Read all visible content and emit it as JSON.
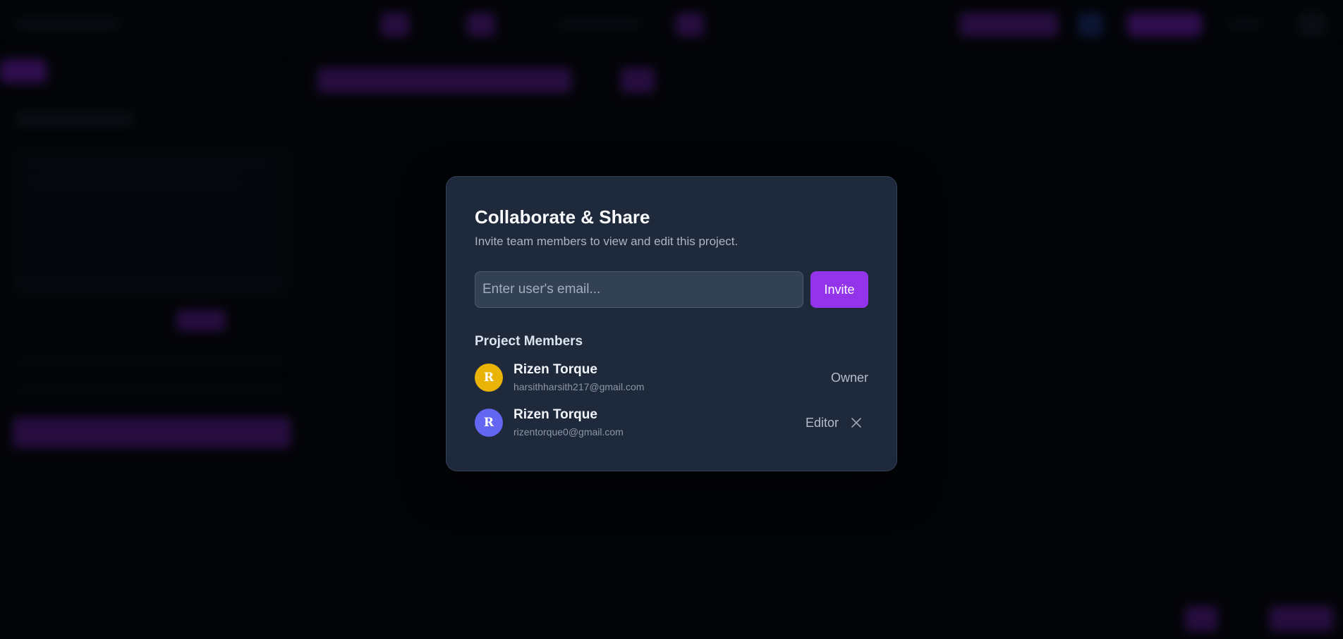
{
  "modal": {
    "title": "Collaborate & Share",
    "subtitle": "Invite team members to view and edit this project.",
    "email_placeholder": "Enter user's email...",
    "email_value": "",
    "invite_label": "Invite",
    "members_heading": "Project Members"
  },
  "members": [
    {
      "initial": "R",
      "name": "Rizen Torque",
      "email": "harsithharsith217@gmail.com",
      "role": "Owner",
      "avatar_color": "#eab308",
      "removable": false
    },
    {
      "initial": "R",
      "name": "Rizen Torque",
      "email": "rizentorque0@gmail.com",
      "role": "Editor",
      "avatar_color": "#6366f1",
      "removable": true
    }
  ],
  "icons": {
    "remove": "close-icon"
  },
  "colors": {
    "accent": "#9333ea",
    "modal_bg": "#1e293b",
    "input_bg": "#334155",
    "page_bg": "#05070d"
  }
}
